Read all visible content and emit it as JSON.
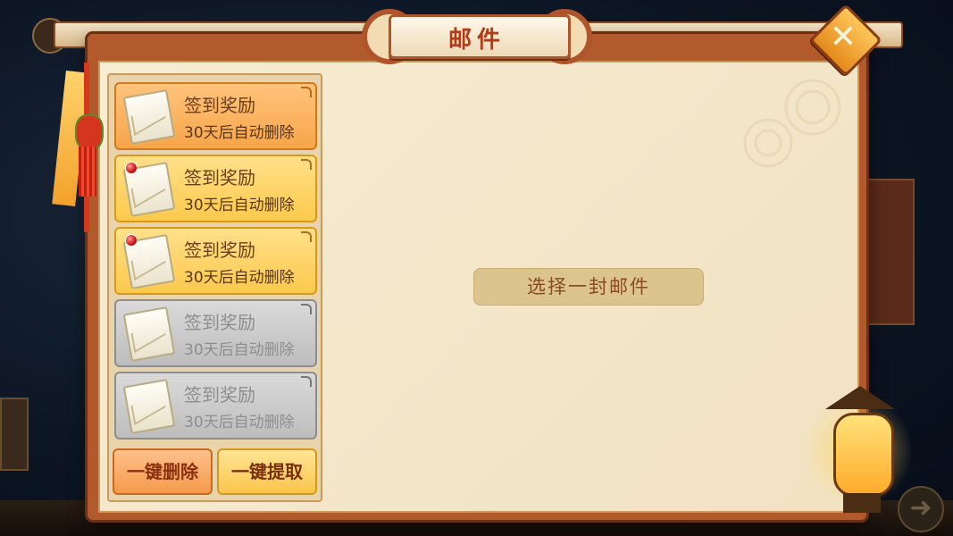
{
  "window": {
    "title": "邮件",
    "close_label": "✕"
  },
  "mail_list": [
    {
      "title": "签到奖励",
      "subtitle": "30天后自动删除",
      "state": "selected",
      "unread": false
    },
    {
      "title": "签到奖励",
      "subtitle": "30天后自动删除",
      "state": "new",
      "unread": true
    },
    {
      "title": "签到奖励",
      "subtitle": "30天后自动删除",
      "state": "new",
      "unread": true
    },
    {
      "title": "签到奖励",
      "subtitle": "30天后自动删除",
      "state": "read",
      "unread": false
    },
    {
      "title": "签到奖励",
      "subtitle": "30天后自动删除",
      "state": "read",
      "unread": false
    }
  ],
  "actions": {
    "delete_all": "一键删除",
    "claim_all": "一键提取"
  },
  "detail": {
    "placeholder": "选择一封邮件"
  },
  "colors": {
    "frame": "#b35a2d",
    "paper": "#f6ecd2",
    "selected_item": "#f7a54a",
    "new_item": "#fcc94c",
    "read_item": "#bdbdbd",
    "title_text": "#b23a16"
  },
  "icons": {
    "close": "close-icon",
    "envelope": "envelope-icon",
    "unread": "unread-dot-icon",
    "lantern": "lantern-icon"
  }
}
